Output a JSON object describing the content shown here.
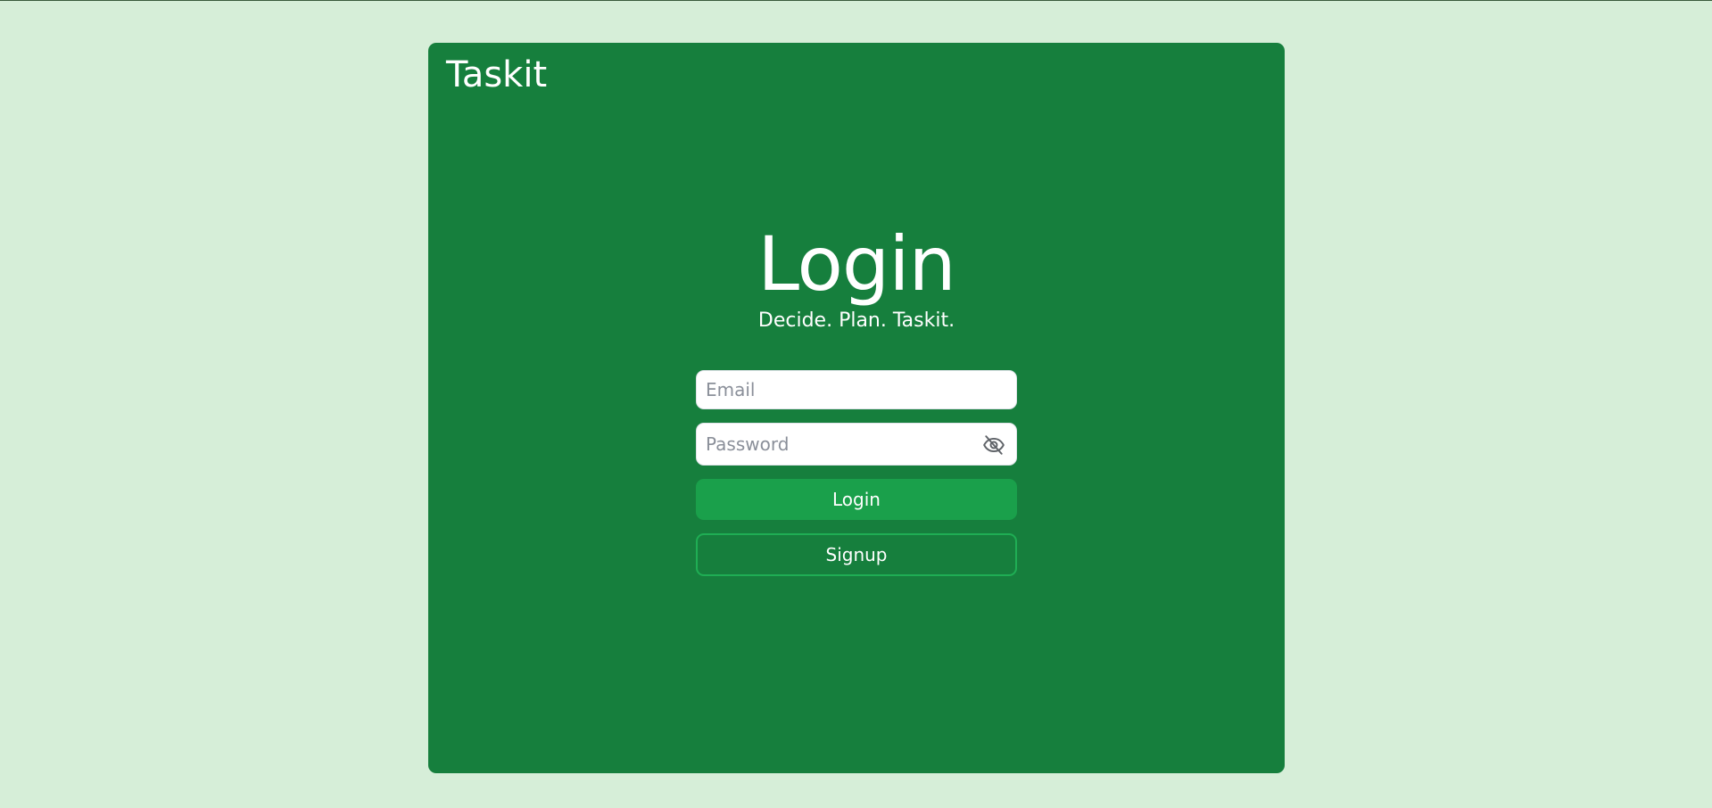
{
  "app": {
    "brand": "Taskit"
  },
  "login": {
    "title": "Login",
    "subtitle": "Decide. Plan. Taskit.",
    "email_placeholder": "Email",
    "email_value": "",
    "password_placeholder": "Password",
    "password_value": "",
    "password_toggle_icon": "eye-slash-icon",
    "login_label": "Login",
    "signup_label": "Signup"
  },
  "colors": {
    "page_background": "#d6eed8",
    "card_background": "#167f3d",
    "primary_button": "#1aa04b",
    "outline_border": "#1fae54"
  }
}
